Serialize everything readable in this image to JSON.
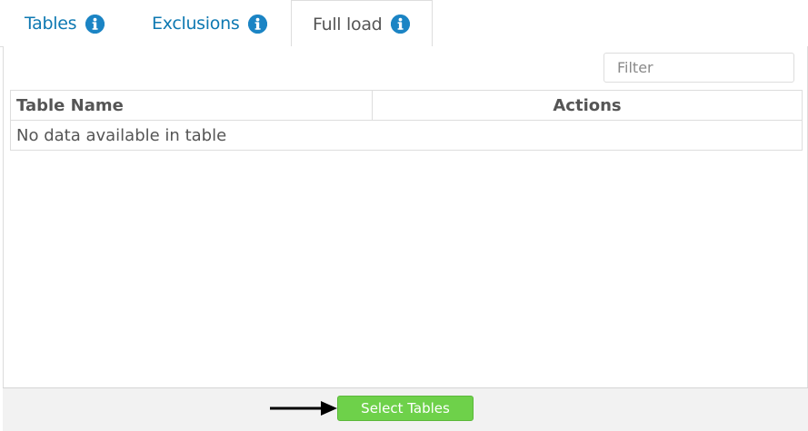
{
  "tabs": [
    {
      "label": "Tables",
      "icon": "info-icon",
      "active": false
    },
    {
      "label": "Exclusions",
      "icon": "info-icon",
      "active": false
    },
    {
      "label": "Full load",
      "icon": "info-icon",
      "active": true
    }
  ],
  "filter": {
    "placeholder": "Filter",
    "value": ""
  },
  "table": {
    "columns": [
      "Table Name",
      "Actions"
    ],
    "empty_message": "No data available in table"
  },
  "footer": {
    "select_button_label": "Select Tables"
  },
  "colors": {
    "tab_link": "#0e79b2",
    "info_icon": "#1b84c4",
    "button_green": "#6ed14a"
  }
}
